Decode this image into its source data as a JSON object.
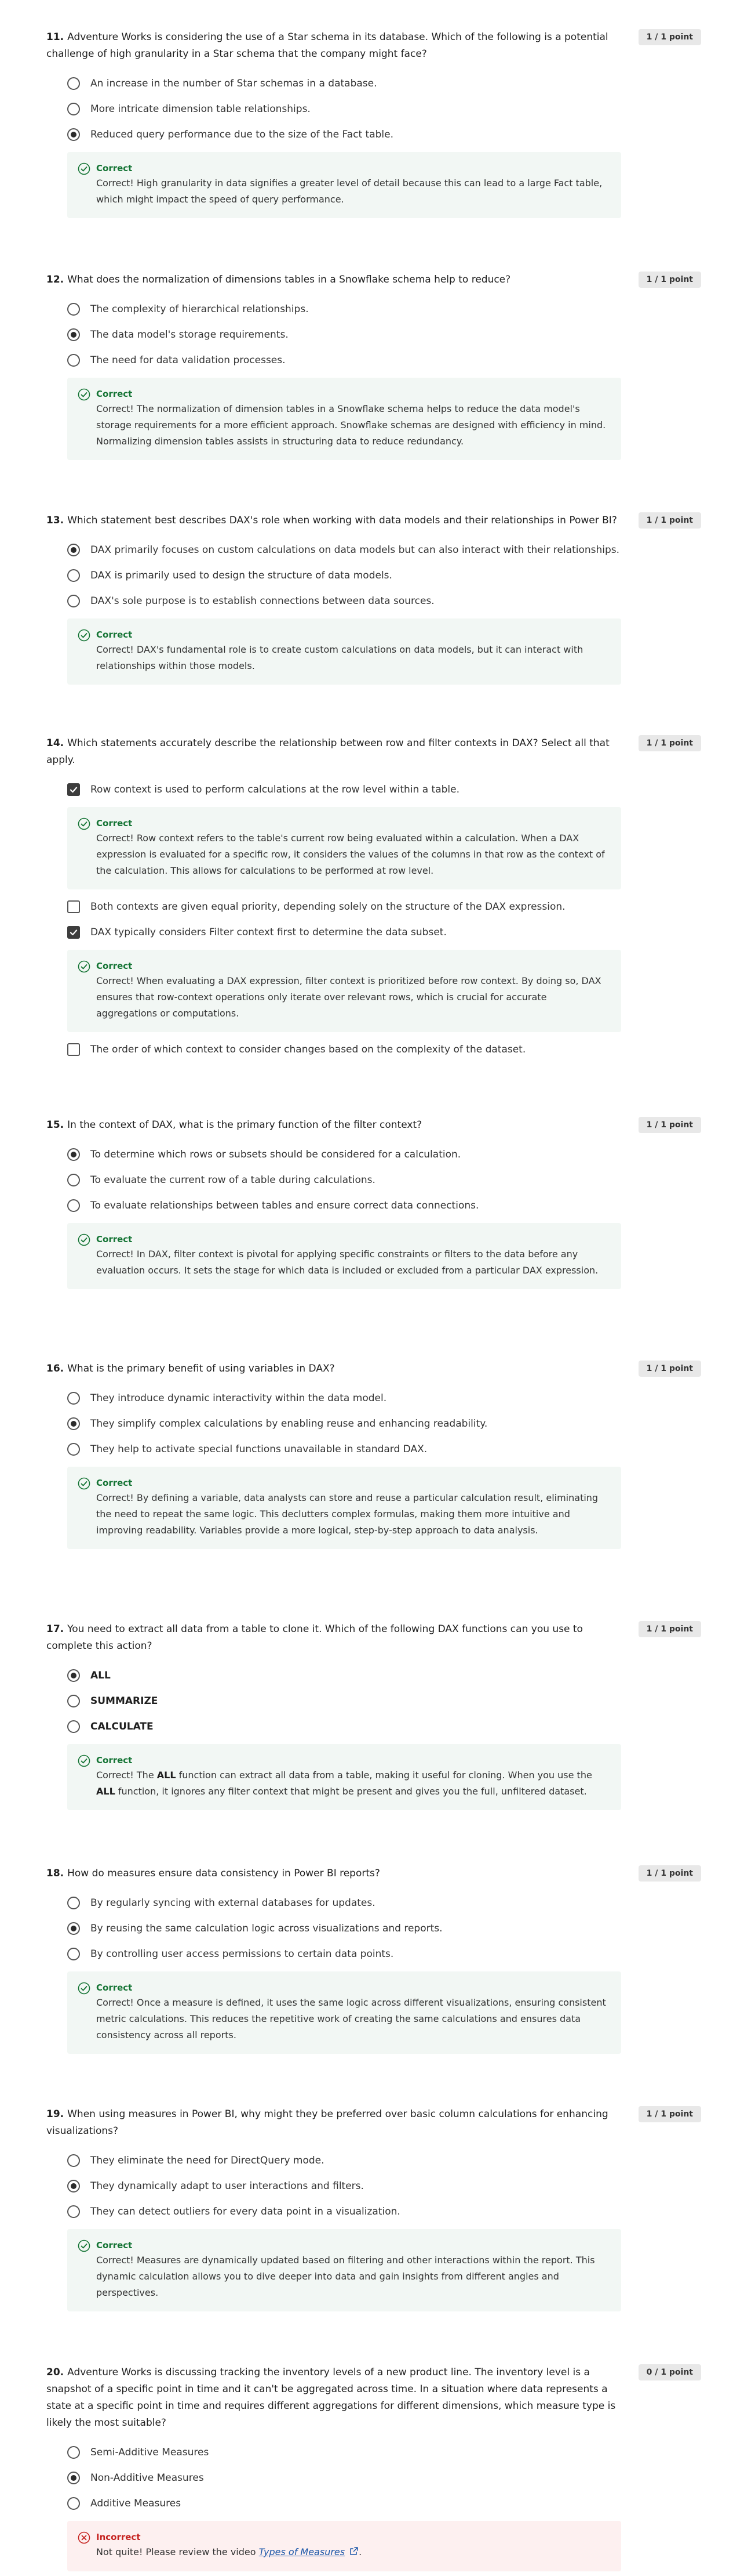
{
  "questions": [
    {
      "number": "11.",
      "text": "Adventure Works is considering the use of a Star schema in its database. Which of the following is a potential challenge of high granularity in a Star schema that the company might face?",
      "score": "1 / 1 point",
      "input_type": "radio",
      "options": [
        {
          "label": "An increase in the number of Star schemas in a database.",
          "checked": false
        },
        {
          "label": "More intricate dimension table relationships.",
          "checked": false
        },
        {
          "label": "Reduced query performance due to the size of the Fact table.",
          "checked": true
        }
      ],
      "feedback": [
        {
          "after": 2,
          "status": "Correct",
          "text": "Correct! High granularity in data signifies a greater level of detail because this can lead to a large Fact table, which might impact the speed of query performance."
        }
      ]
    },
    {
      "number": "12.",
      "text": "What does the normalization of dimensions tables in a Snowflake schema help to reduce?",
      "score": "1 / 1 point",
      "input_type": "radio",
      "options": [
        {
          "label": "The complexity of hierarchical relationships.",
          "checked": false
        },
        {
          "label": "The data model's storage requirements.",
          "checked": true
        },
        {
          "label": "The need for data validation processes.",
          "checked": false
        }
      ],
      "feedback": [
        {
          "after": 2,
          "status": "Correct",
          "text": "Correct! The normalization of dimension tables in a Snowflake schema helps to reduce the data model's storage requirements for a more efficient approach. Snowflake schemas are designed with efficiency in mind. Normalizing dimension tables assists in structuring data to reduce redundancy."
        }
      ]
    },
    {
      "number": "13.",
      "text": "Which statement best describes DAX's role when working with data models and their relationships in Power BI?",
      "score": "1 / 1 point",
      "input_type": "radio",
      "options": [
        {
          "label": "DAX primarily focuses on custom calculations on data models but can also interact with their relationships.",
          "checked": true
        },
        {
          "label": "DAX is primarily used to design the structure of data models.",
          "checked": false
        },
        {
          "label": "DAX's sole purpose is to establish connections between data sources.",
          "checked": false
        }
      ],
      "feedback": [
        {
          "after": 2,
          "status": "Correct",
          "text": "Correct! DAX's fundamental role is to create custom calculations on data models, but it can interact with relationships within those models."
        }
      ]
    },
    {
      "number": "14.",
      "text": "Which statements accurately describe the relationship between row and filter contexts in DAX? Select all that apply.",
      "score": "1 / 1 point",
      "input_type": "checkbox",
      "options": [
        {
          "label": "Row context is used to perform calculations at the row level within a table.",
          "checked": true
        },
        {
          "label": "Both contexts are given equal priority, depending solely on the structure of the DAX expression.",
          "checked": false
        },
        {
          "label": "DAX typically considers Filter context first to determine the data subset.",
          "checked": true
        },
        {
          "label": "The order of which context to consider changes based on the complexity of the dataset.",
          "checked": false
        }
      ],
      "feedback": [
        {
          "after": 0,
          "status": "Correct",
          "text": "Correct! Row context refers to the table's current row being evaluated within a calculation. When a DAX expression is evaluated for a specific row, it considers the values of the columns in that row as the context of the calculation. This allows for calculations to be performed at row level."
        },
        {
          "after": 2,
          "status": "Correct",
          "text": "Correct! When evaluating a DAX expression, filter context is prioritized before row context. By doing so, DAX ensures that row-context operations only iterate over relevant rows, which is crucial for accurate aggregations or computations."
        }
      ]
    },
    {
      "number": "15.",
      "text": "In the context of DAX, what is the primary function of the filter context?",
      "score": "1 / 1 point",
      "input_type": "radio",
      "options": [
        {
          "label": "To determine which rows or subsets should be considered for a calculation.",
          "checked": true
        },
        {
          "label": "To evaluate the current row of a table during calculations.",
          "checked": false
        },
        {
          "label": "To evaluate relationships between tables and ensure correct data connections.",
          "checked": false
        }
      ],
      "feedback": [
        {
          "after": 2,
          "status": "Correct",
          "text": "Correct! In DAX, filter context is pivotal for applying specific constraints or filters to the data before any evaluation occurs. It sets the stage for which data is included or excluded from a particular DAX expression."
        }
      ]
    },
    {
      "number": "16.",
      "text": "What is the primary benefit of using variables in DAX?",
      "score": "1 / 1 point",
      "input_type": "radio",
      "options": [
        {
          "label": "They introduce dynamic interactivity within the data model.",
          "checked": false
        },
        {
          "label": "They simplify complex calculations by enabling reuse and enhancing readability.",
          "checked": true
        },
        {
          "label": "They help to activate special functions unavailable in standard DAX.",
          "checked": false
        }
      ],
      "feedback": [
        {
          "after": 2,
          "status": "Correct",
          "text": "Correct! By defining a variable, data analysts can store and reuse a particular calculation result, eliminating the need to repeat the same logic. This declutters complex formulas, making them more intuitive and improving readability. Variables provide a more logical, step-by-step approach to data analysis."
        }
      ]
    },
    {
      "number": "17.",
      "text": "You need to extract all data from a table to clone it. Which of the following DAX functions can you use to complete this action?",
      "score": "1 / 1 point",
      "input_type": "radio",
      "bold_options": true,
      "options": [
        {
          "label": "ALL",
          "checked": true
        },
        {
          "label": "SUMMARIZE",
          "checked": false
        },
        {
          "label": "CALCULATE",
          "checked": false
        }
      ],
      "feedback": [
        {
          "after": 2,
          "status": "Correct",
          "parts": [
            "Correct! The ",
            "ALL",
            " function can extract all data from a table, making it useful for cloning. When you use the ",
            "ALL",
            " function, it ignores any filter context that might be present and gives you the full, unfiltered dataset."
          ]
        }
      ]
    },
    {
      "number": "18.",
      "text": "How do measures ensure data consistency in Power BI reports?",
      "score": "1 / 1 point",
      "input_type": "radio",
      "options": [
        {
          "label": "By regularly syncing with external databases for updates.",
          "checked": false
        },
        {
          "label": "By reusing the same calculation logic across visualizations and reports.",
          "checked": true
        },
        {
          "label": "By controlling user access permissions to certain data points.",
          "checked": false
        }
      ],
      "feedback": [
        {
          "after": 2,
          "status": "Correct",
          "text": "Correct! Once a measure is defined, it uses the same logic across different visualizations, ensuring consistent metric calculations. This reduces the repetitive work of creating the same calculations and ensures data consistency across all reports."
        }
      ]
    },
    {
      "number": "19.",
      "text": "When using measures in Power BI, why might they be preferred over basic column calculations for enhancing visualizations?",
      "score": "1 / 1 point",
      "input_type": "radio",
      "options": [
        {
          "label": "They eliminate the need for DirectQuery mode.",
          "checked": false
        },
        {
          "label": "They dynamically adapt to user interactions and filters.",
          "checked": true
        },
        {
          "label": "They can detect outliers for every data point in a visualization.",
          "checked": false
        }
      ],
      "feedback": [
        {
          "after": 2,
          "status": "Correct",
          "text": "Correct! Measures are dynamically updated based on filtering and other interactions within the report. This dynamic calculation allows you to dive deeper into data and gain insights from different angles and perspectives."
        }
      ]
    },
    {
      "number": "20.",
      "text": "Adventure Works is discussing tracking the inventory levels of a new product line. The inventory level is a snapshot of a specific point in time and it can't be aggregated across time. In a situation where data represents a state at a specific point in time and requires different aggregations for different dimensions, which measure type is likely the most suitable?",
      "score": "0 / 1 point",
      "input_type": "radio",
      "options": [
        {
          "label": "Semi-Additive Measures",
          "checked": false
        },
        {
          "label": "Non-Additive Measures",
          "checked": true
        },
        {
          "label": "Additive Measures",
          "checked": false
        }
      ],
      "feedback": [
        {
          "after": 2,
          "status": "Incorrect",
          "lead": "Not quite! Please review the video ",
          "link": "Types of Measures",
          "tail": "."
        }
      ]
    }
  ],
  "colors": {
    "correct": "#137333",
    "incorrect": "#c5221f",
    "correct_bg": "#f2f7f4",
    "incorrect_bg": "#fdf0f0",
    "link": "#1a56a8"
  },
  "icons": {
    "correct": "check-circle-icon",
    "incorrect": "x-circle-icon",
    "external_link": "external-link-icon"
  }
}
